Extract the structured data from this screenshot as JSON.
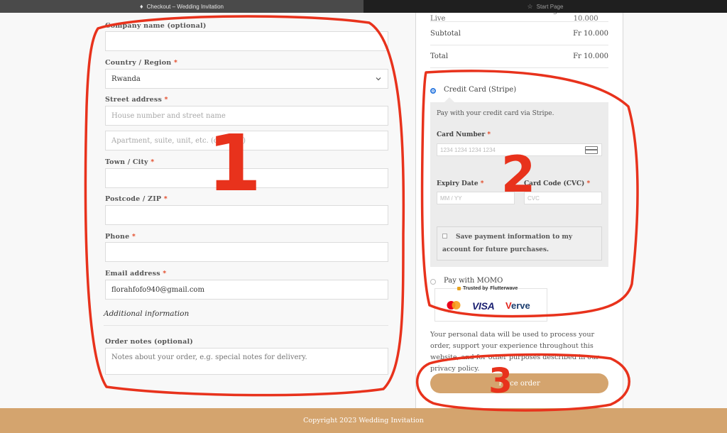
{
  "browser": {
    "active_tab": "Checkout – Wedding Invitation",
    "inactive_tab": "Start Page"
  },
  "form": {
    "company": {
      "label": "Company name (optional)",
      "value": ""
    },
    "country": {
      "label": "Country / Region",
      "required": "*",
      "value": "Rwanda"
    },
    "street": {
      "label": "Street address",
      "required": "*",
      "placeholder1": "House number and street name",
      "placeholder2": "Apartment, suite, unit, etc. (optional)"
    },
    "city": {
      "label": "Town / City",
      "required": "*",
      "value": ""
    },
    "postcode": {
      "label": "Postcode / ZIP",
      "required": "*",
      "value": ""
    },
    "phone": {
      "label": "Phone",
      "required": "*",
      "value": ""
    },
    "email": {
      "label": "Email address",
      "required": "*",
      "value": "florahfofo940@gmail.com"
    },
    "additional_heading": "Additional information",
    "notes": {
      "label": "Order notes (optional)",
      "placeholder": "Notes about your order, e.g. special notes for delivery."
    }
  },
  "summary": {
    "cut_item": {
      "name": "Watch The Ben & Pamella Wedding Live",
      "price": "Fr 10.000"
    },
    "subtotal": {
      "label": "Subtotal",
      "value": "Fr 10.000"
    },
    "total": {
      "label": "Total",
      "value": "Fr 10.000"
    }
  },
  "payment": {
    "stripe_label": "Credit Card (Stripe)",
    "stripe_desc": "Pay with your credit card via Stripe.",
    "card_number_label": "Card Number",
    "card_number_placeholder": "1234 1234 1234 1234",
    "expiry_label": "Expiry Date",
    "expiry_placeholder": "MM / YY",
    "cvc_label": "Card Code (CVC)",
    "cvc_placeholder": "CVC",
    "required": "*",
    "save_label": "Save payment information to my account for future purchases.",
    "momo_label": "Pay with MOMO",
    "trusted_by": "Trusted by",
    "flutterwave": "Flutterwave",
    "brands": {
      "mastercard": "mastercard",
      "visa": "VISA",
      "verve_v": "V",
      "verve_rest": "erve"
    }
  },
  "privacy_text": "Your personal data will be used to process your order, support your experience throughout this website, and for other purposes described in our privacy policy.",
  "place_order": "Place order",
  "footer": "Copyright 2023 Wedding Invitation",
  "annotations": {
    "one": "1",
    "two": "2",
    "three": "3"
  },
  "colors": {
    "accent": "#d4a46e",
    "required": "#e2401c",
    "annotation": "#e8321c",
    "radio": "#2f7be0"
  }
}
